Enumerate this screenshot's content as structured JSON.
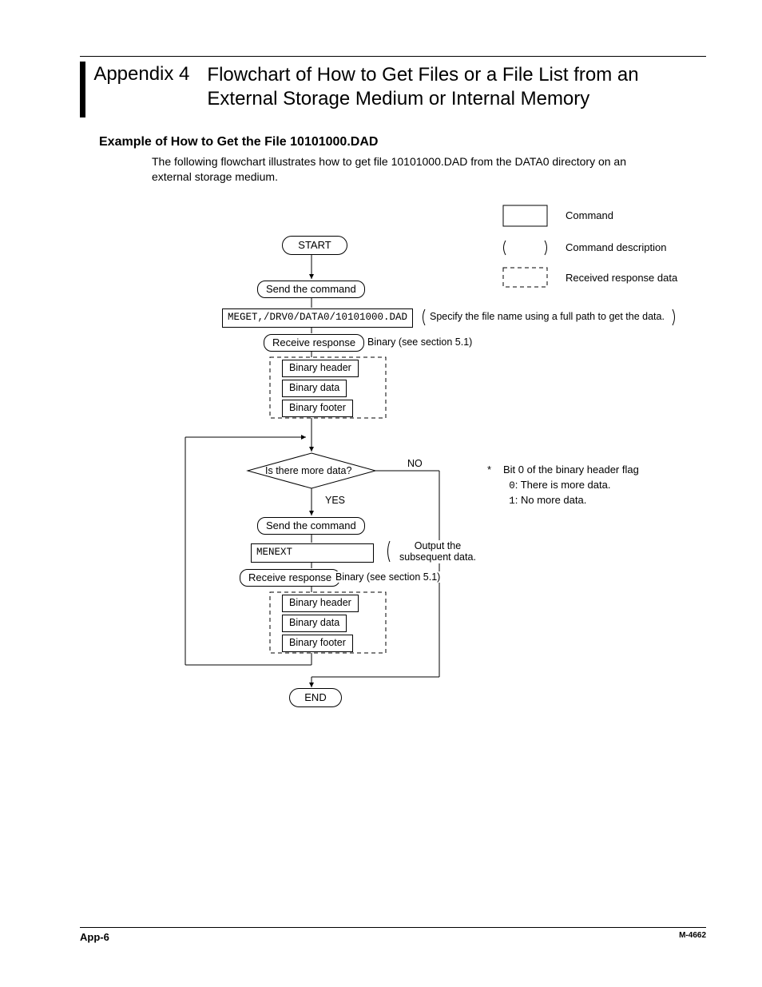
{
  "header": {
    "appendix_label": "Appendix 4",
    "title": "Flowchart of How to Get Files or a File List from an External Storage Medium or Internal Memory"
  },
  "subhead": "Example of How to Get the File 10101000.DAD",
  "intro": "The following flowchart illustrates how to get file 10101000.DAD from the DATA0 directory on an external storage medium.",
  "legend": {
    "cmd": "Command",
    "desc": "Command description",
    "resp": "Received response data"
  },
  "flow": {
    "start": "START",
    "send1": "Send the command",
    "cmd1": "MEGET,/DRV0/DATA0/10101000.DAD",
    "cmd1_note": "Specify the file name using a full path to get the data.",
    "recv1": "Receive response",
    "recv1_note": "Binary (see section 5.1)",
    "block": {
      "h": "Binary header",
      "d": "Binary data",
      "f": "Binary footer"
    },
    "decision": "Is there more data?",
    "no": "NO",
    "yes": "YES",
    "send2": "Send the command",
    "cmd2": "MENEXT",
    "cmd2_note_l1": "Output the",
    "cmd2_note_l2": "subsequent data.",
    "recv2": "Receive response",
    "recv2_note": "Binary (see section 5.1)",
    "end": "END"
  },
  "side_note": {
    "star": "*",
    "title": "Bit 0 of the binary header flag",
    "line0_code": "0",
    "line0_text": ": There is more data.",
    "line1_code": "1",
    "line1_text": ": No more data."
  },
  "footer": {
    "page": "App-6",
    "doc": "M-4662"
  }
}
